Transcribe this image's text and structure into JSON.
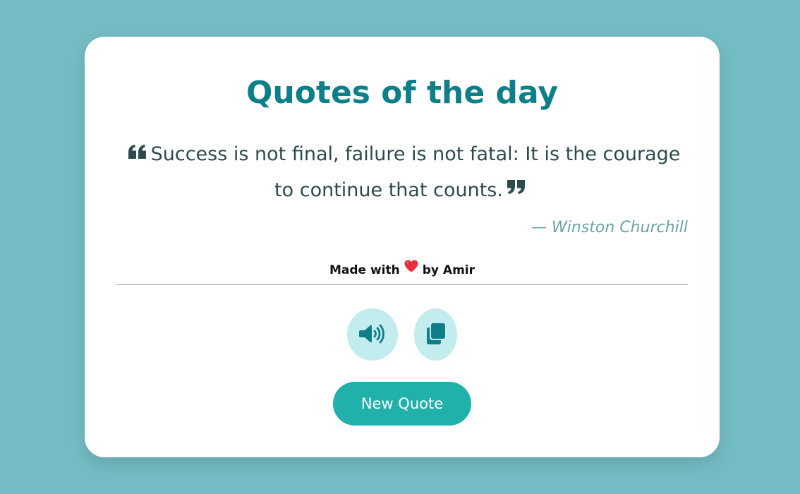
{
  "card": {
    "title": "Quotes of the day",
    "quote": {
      "open_icon": "quote-left-icon",
      "text": "Success is not final, failure is not fatal: It is the courage to continue that counts.",
      "close_icon": "quote-right-icon"
    },
    "author": "— Winston Churchill",
    "credit": {
      "prefix": "Made with",
      "icon": "heart-icon",
      "suffix": "by Amir"
    },
    "actions": {
      "speak_icon": "volume-icon",
      "copy_icon": "copy-icon"
    },
    "new_quote_label": "New Quote"
  },
  "colors": {
    "background": "#74bcc4",
    "title": "#0e7e89",
    "button": "#20b2aa",
    "icon_button_bg": "#c3ecef",
    "heart": "#e8303c"
  }
}
